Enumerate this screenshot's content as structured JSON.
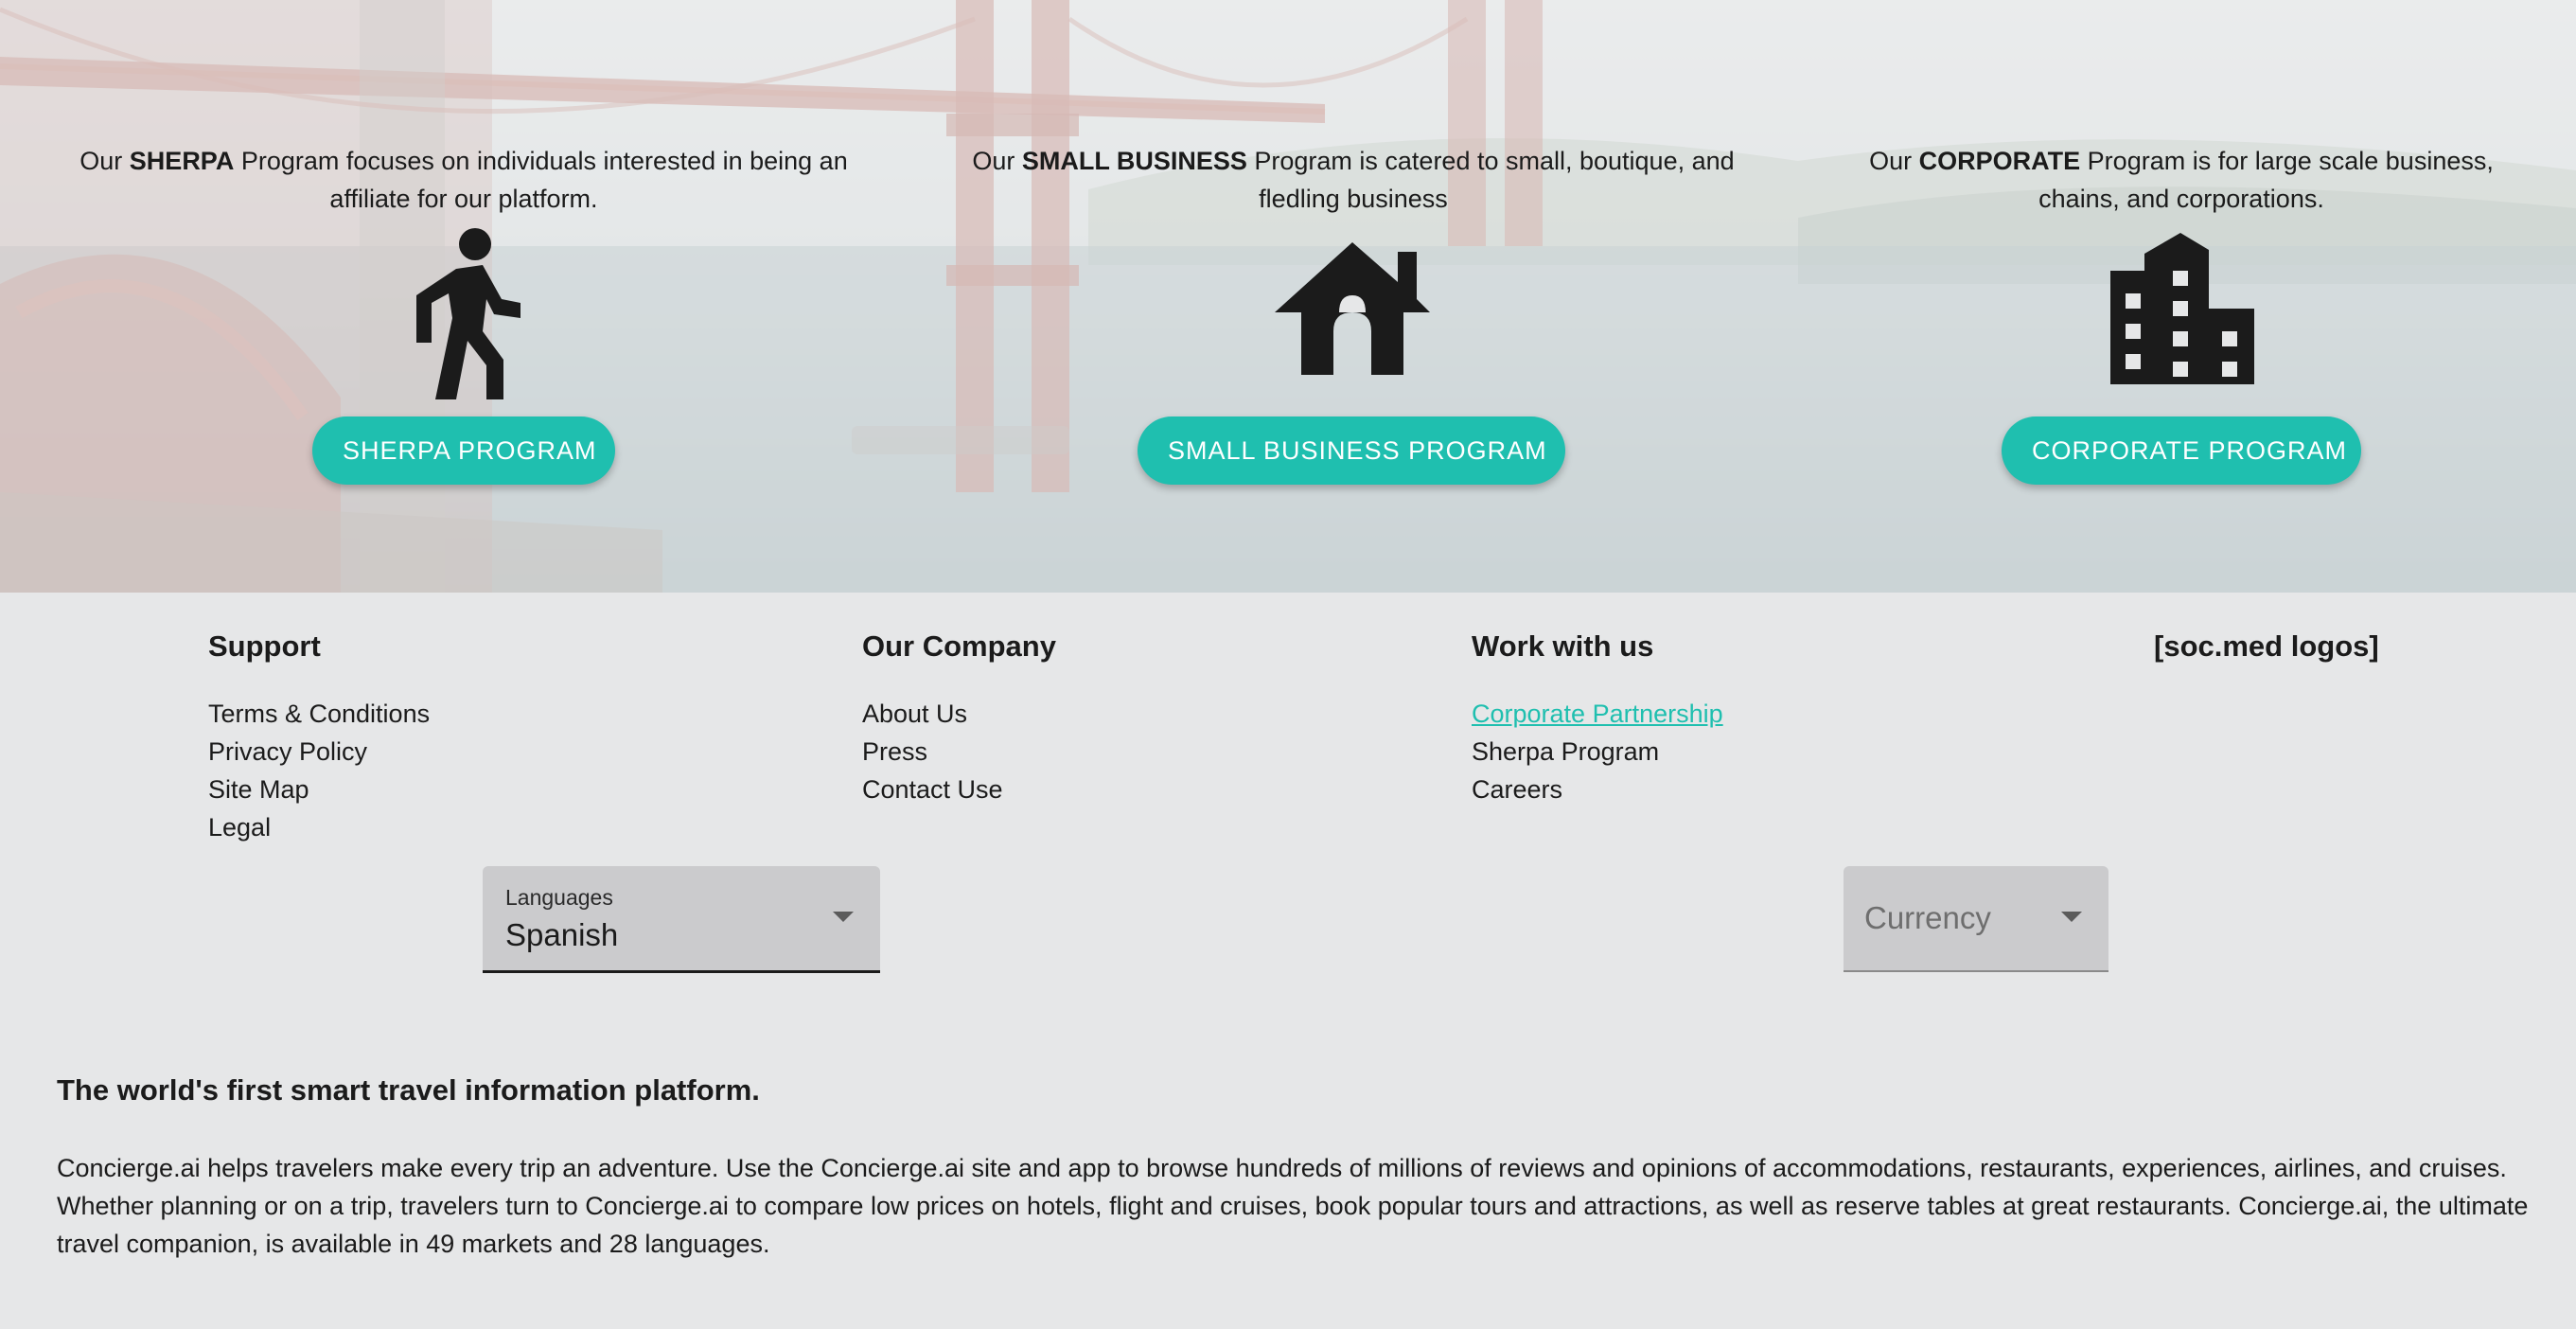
{
  "programs": {
    "sherpa": {
      "prefix": "Our ",
      "bold": "SHERPA",
      "rest": " Program focuses on individuals interested in being an affiliate for our platform.",
      "button": "SHERPA PROGRAM",
      "icon": "walking-person-icon"
    },
    "small_business": {
      "prefix": "Our ",
      "bold": "SMALL BUSINESS",
      "rest": " Program is catered to small, boutique, and fledling business",
      "button": "SMALL BUSINESS PROGRAM",
      "icon": "house-icon"
    },
    "corporate": {
      "prefix": "Our ",
      "bold": "CORPORATE",
      "rest": " Program is for large scale business, chains, and corporations.",
      "button": "CORPORATE PROGRAM",
      "icon": "office-building-icon"
    }
  },
  "footer": {
    "support": {
      "title": "Support",
      "links": [
        "Terms & Conditions",
        "Privacy Policy",
        "Site Map",
        "Legal"
      ]
    },
    "company": {
      "title": "Our Company",
      "links": [
        "About Us",
        "Press",
        "Contact Use"
      ]
    },
    "work": {
      "title": "Work with us",
      "links": [
        "Corporate Partnership",
        "Sherpa Program",
        "Careers"
      ]
    },
    "social": {
      "title": "[soc.med logos]"
    },
    "languages": {
      "label": "Languages",
      "value": "Spanish"
    },
    "currency": {
      "placeholder": "Currency"
    },
    "about": {
      "title": "The world's first smart travel information platform.",
      "body": "Concierge.ai helps travelers make every trip an adventure. Use the Concierge.ai site and app to browse hundreds of millions of reviews and opinions of accommodations, restaurants, experiences, airlines, and cruises. Whether planning or on a trip, travelers turn to Concierge.ai to compare low prices on hotels, flight and cruises, book popular tours and attractions, as well as reserve tables at great restaurants. Concierge.ai, the ultimate travel companion, is available in 49 markets and 28 languages."
    }
  },
  "colors": {
    "accent": "#1fbfaf",
    "text": "#1b1b1b",
    "page_bg": "#e6e7e8",
    "select_bg": "#cbcbcd"
  }
}
